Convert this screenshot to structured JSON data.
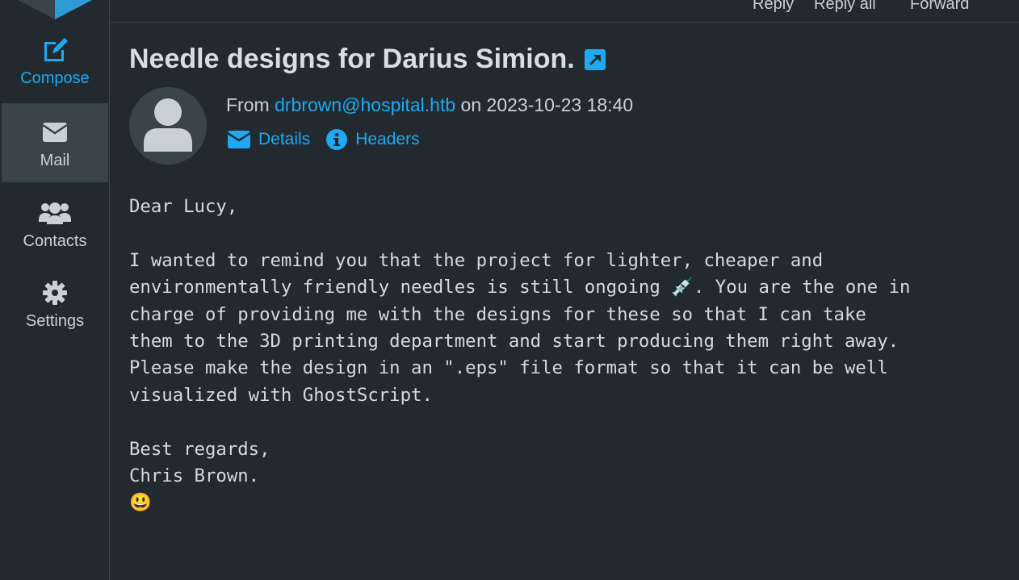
{
  "sidebar": {
    "logo_icon": "brand-logo-icon",
    "items": [
      {
        "label": "Compose",
        "icon": "pencil-square-icon",
        "active": false,
        "accent": "#1ea9f2"
      },
      {
        "label": "Mail",
        "icon": "envelope-icon",
        "active": true
      },
      {
        "label": "Contacts",
        "icon": "users-icon",
        "active": false
      },
      {
        "label": "Settings",
        "icon": "gear-icon",
        "active": false
      }
    ]
  },
  "toolbar": {
    "reply_label": "Reply",
    "reply_all_label": "Reply all",
    "forward_label": "Forward"
  },
  "message": {
    "subject": "Needle designs for Darius Simion.",
    "open_external_icon": "open-in-new-window-icon",
    "from_prefix": "From",
    "from_email": "drbrown@hospital.htb",
    "date_prefix": "on",
    "date": "2023-10-23 18:40",
    "details_label": "Details",
    "headers_label": "Headers",
    "body_lines": [
      "Dear Lucy,",
      "",
      "I wanted to remind you that the project for lighter, cheaper and",
      "environmentally friendly needles is still ongoing 💉. You are the one in",
      "charge of providing me with the designs for these so that I can take",
      "them to the 3D printing department and start producing them right away.",
      "Please make the design in an \".eps\" file format so that it can be well",
      "visualized with GhostScript.",
      "",
      "Best regards,",
      "Chris Brown.",
      "😃"
    ]
  },
  "colors": {
    "background": "#222a2f",
    "active_nav": "#3a444b",
    "accent": "#1ea9f2",
    "text": "#c9d1d6"
  }
}
